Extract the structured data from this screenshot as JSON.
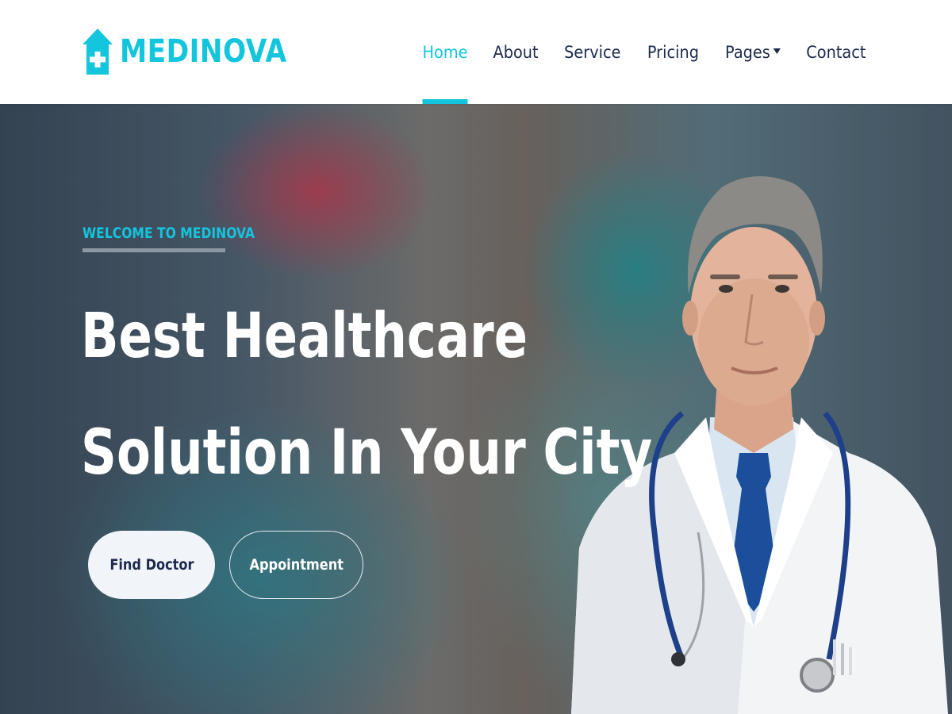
{
  "colors": {
    "accent": "#13c5dd",
    "dark": "#1d2a4d",
    "white": "#ffffff",
    "light_button": "#f1f4f8"
  },
  "brand": {
    "name": "MEDINOVA",
    "icon": "house-medical-icon"
  },
  "nav": {
    "items": [
      {
        "label": "Home",
        "active": true
      },
      {
        "label": "About",
        "active": false
      },
      {
        "label": "Service",
        "active": false
      },
      {
        "label": "Pricing",
        "active": false
      },
      {
        "label": "Pages",
        "active": false,
        "dropdown": true
      },
      {
        "label": "Contact",
        "active": false
      }
    ]
  },
  "hero": {
    "eyebrow": "WELCOME TO MEDINOVA",
    "headline_line1": "Best Healthcare",
    "headline_line2": "Solution In Your City",
    "buttons": {
      "find_doctor": "Find Doctor",
      "appointment": "Appointment"
    },
    "image": "doctor-portrait-with-stethoscope"
  }
}
